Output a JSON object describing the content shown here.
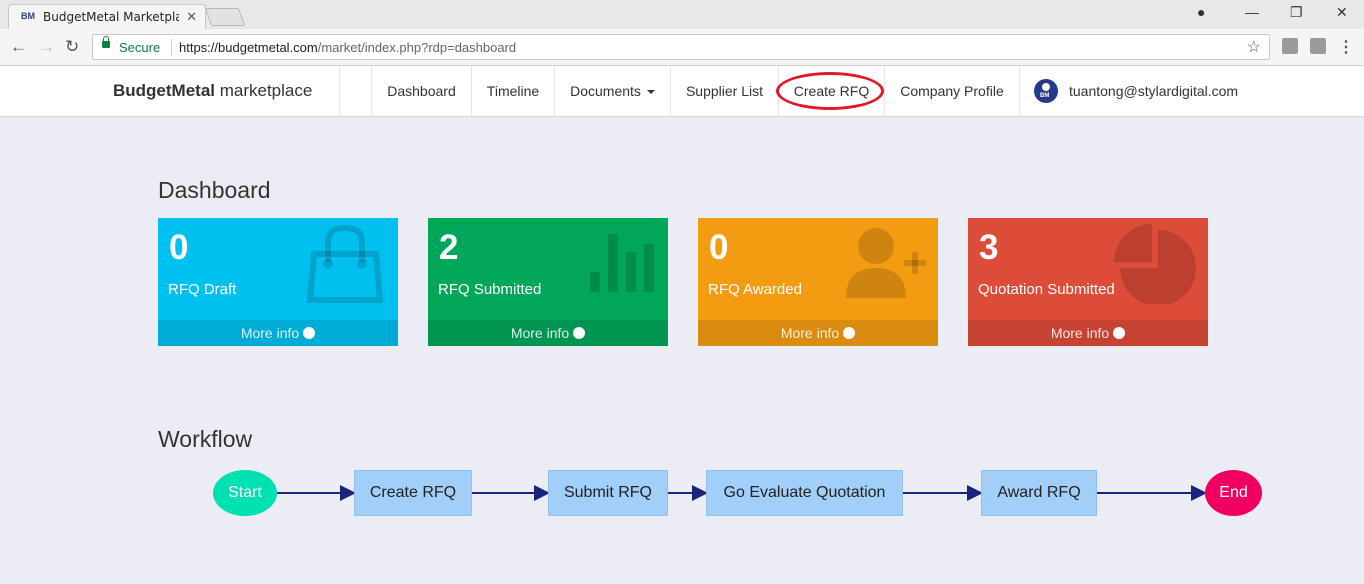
{
  "browser": {
    "tab_title": "BudgetMetal Marketplace",
    "tab_favicon_text": "BM",
    "secure_label": "Secure",
    "url_host": "https://budgetmetal.com",
    "url_path": "/market/index.php?rdp=dashboard"
  },
  "navbar": {
    "brand_bold": "BudgetMetal",
    "brand_rest": " marketplace",
    "items": [
      {
        "label": "Dashboard"
      },
      {
        "label": "Timeline"
      },
      {
        "label": "Documents"
      },
      {
        "label": "Supplier List"
      },
      {
        "label": "Create RFQ"
      },
      {
        "label": "Company Profile"
      }
    ],
    "user_email": "tuantong@stylardigital.com",
    "avatar_text": "BM"
  },
  "dashboard": {
    "title": "Dashboard",
    "boxes": [
      {
        "count": "0",
        "label": "RFQ Draft",
        "more": "More info",
        "icon": "shopping-bag-icon",
        "color": "#00c0ef"
      },
      {
        "count": "2",
        "label": "RFQ Submitted",
        "more": "More info",
        "icon": "bar-chart-icon",
        "color": "#00a65a"
      },
      {
        "count": "0",
        "label": "RFQ Awarded",
        "more": "More info",
        "icon": "user-plus-icon",
        "color": "#f39c12"
      },
      {
        "count": "3",
        "label": "Quotation Submitted",
        "more": "More info",
        "icon": "pie-chart-icon",
        "color": "#dd4b39"
      }
    ]
  },
  "workflow": {
    "title": "Workflow",
    "start": "Start",
    "steps": [
      "Create RFQ",
      "Submit RFQ",
      "Go Evaluate Quotation",
      "Award RFQ"
    ],
    "end": "End",
    "colors": {
      "start": "#00e0b0",
      "step": "#a2cff9",
      "end": "#ef0060",
      "arrow": "#1a237e"
    }
  }
}
